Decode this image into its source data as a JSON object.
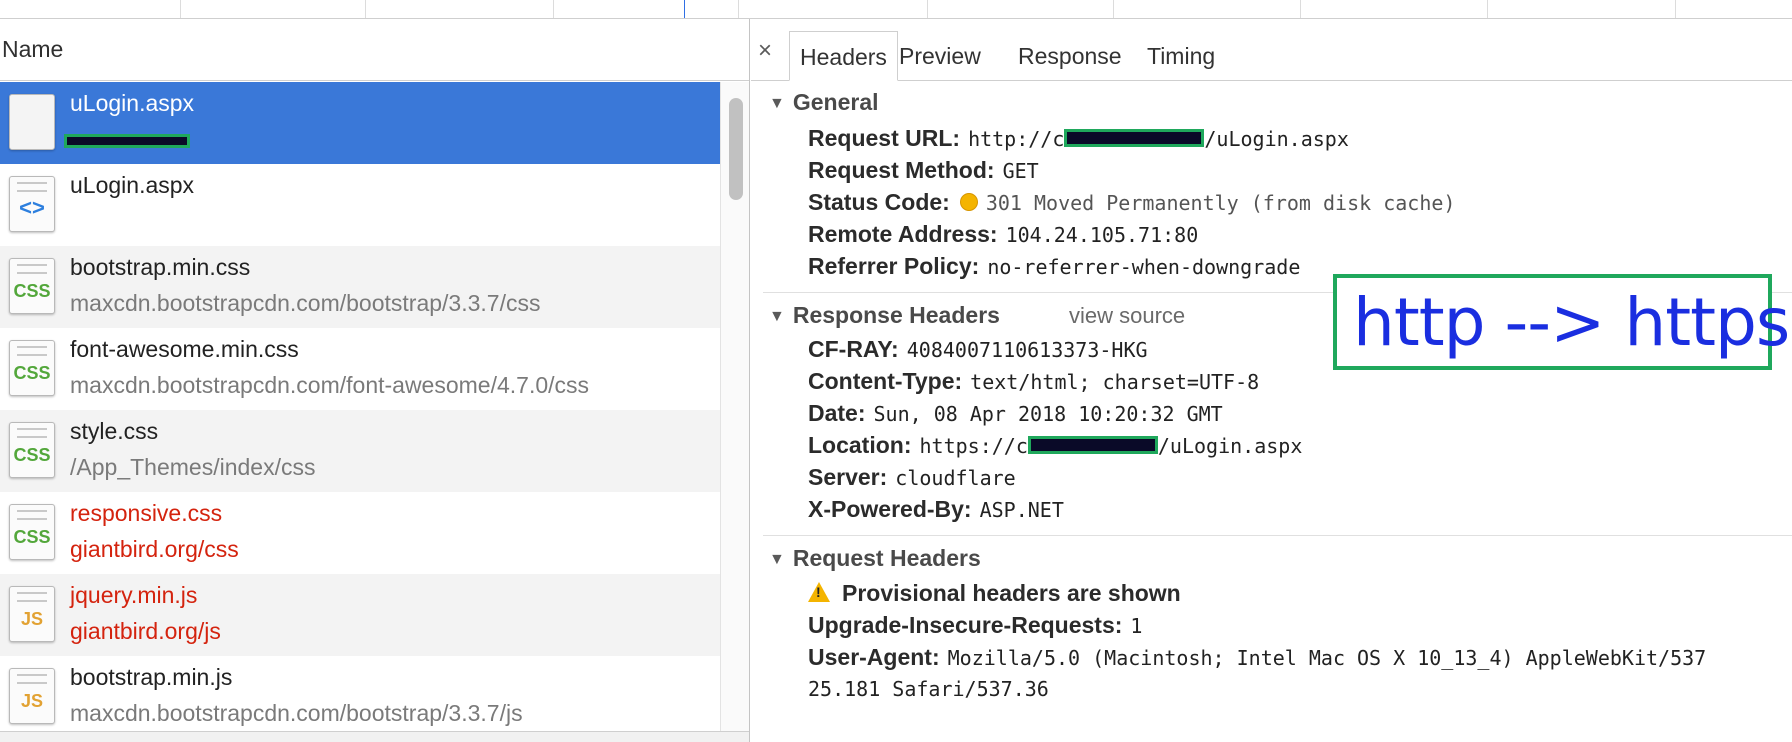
{
  "left_pane": {
    "column_header": "Name",
    "requests": [
      {
        "name": "uLogin.aspx",
        "path": "",
        "type": "document",
        "selected": true,
        "error": false
      },
      {
        "name": "uLogin.aspx",
        "path": "",
        "type": "html",
        "selected": false,
        "error": false
      },
      {
        "name": "bootstrap.min.css",
        "path": "maxcdn.bootstrapcdn.com/bootstrap/3.3.7/css",
        "type": "css",
        "selected": false,
        "error": false
      },
      {
        "name": "font-awesome.min.css",
        "path": "maxcdn.bootstrapcdn.com/font-awesome/4.7.0/css",
        "type": "css",
        "selected": false,
        "error": false
      },
      {
        "name": "style.css",
        "path": "/App_Themes/index/css",
        "type": "css",
        "selected": false,
        "error": false
      },
      {
        "name": "responsive.css",
        "path": "giantbird.org/css",
        "type": "css",
        "selected": false,
        "error": true
      },
      {
        "name": "jquery.min.js",
        "path": "giantbird.org/js",
        "type": "js",
        "selected": false,
        "error": true
      },
      {
        "name": "bootstrap.min.js",
        "path": "maxcdn.bootstrapcdn.com/bootstrap/3.3.7/js",
        "type": "js",
        "selected": false,
        "error": false
      }
    ],
    "icon_glyphs": {
      "css": "CSS",
      "js": "JS",
      "html": "<>"
    }
  },
  "right_pane": {
    "close_label": "×",
    "tabs": [
      "Headers",
      "Preview",
      "Response",
      "Timing"
    ],
    "active_tab": "Headers",
    "general": {
      "title": "General",
      "request_url_key": "Request URL:",
      "request_url_prefix": "http://c",
      "request_url_suffix": "/uLogin.aspx",
      "request_method_key": "Request Method:",
      "request_method": "GET",
      "status_code_key": "Status Code:",
      "status_code": "301 Moved Permanently (from disk cache)",
      "remote_address_key": "Remote Address:",
      "remote_address": "104.24.105.71:80",
      "referrer_policy_key": "Referrer Policy:",
      "referrer_policy": "no-referrer-when-downgrade"
    },
    "response_headers": {
      "title": "Response Headers",
      "view_source": "view source",
      "items": [
        {
          "key": "CF-RAY:",
          "value": "4084007110613373-HKG"
        },
        {
          "key": "Content-Type:",
          "value": "text/html; charset=UTF-8"
        },
        {
          "key": "Date:",
          "value": "Sun, 08 Apr 2018 10:20:32 GMT"
        },
        {
          "key": "Location:",
          "value_prefix": "https://c",
          "value_suffix": "/uLogin.aspx"
        },
        {
          "key": "Server:",
          "value": "cloudflare"
        },
        {
          "key": "X-Powered-By:",
          "value": "ASP.NET"
        }
      ]
    },
    "request_headers": {
      "title": "Request Headers",
      "provisional_warning": "Provisional headers are shown",
      "upgrade_key": "Upgrade-Insecure-Requests:",
      "upgrade_value": "1",
      "user_agent_key": "User-Agent:",
      "user_agent_line1": "Mozilla/5.0 (Macintosh; Intel Mac OS X 10_13_4) AppleWebKit/537",
      "user_agent_line2": "25.181 Safari/537.36"
    },
    "annotation": "http --> https",
    "colors": {
      "annotation_border": "#1fa85c",
      "annotation_text": "#1a2ee0",
      "selected_row": "#3a78d8",
      "error_text": "#d4230e",
      "status_dot": "#f4b400"
    }
  }
}
